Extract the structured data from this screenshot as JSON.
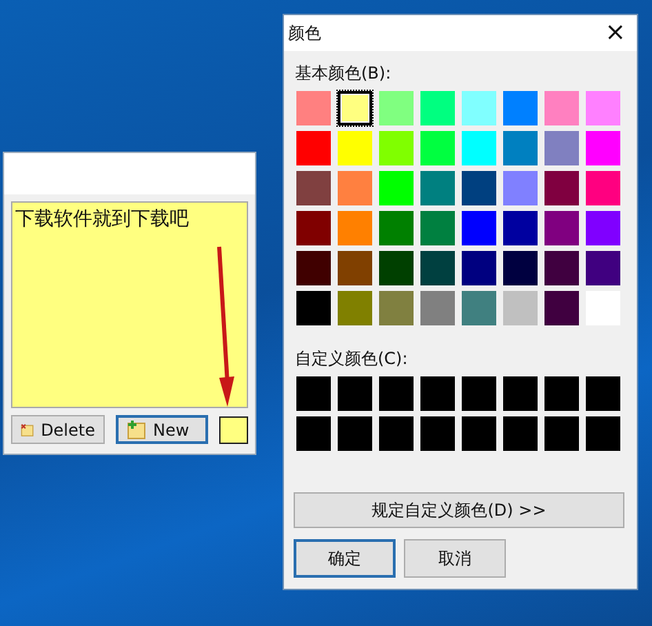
{
  "note": {
    "text": "下载软件就到下载吧",
    "color": "#ffff80",
    "buttons": [
      {
        "label": "Delete",
        "kind": "delete",
        "selected": false
      },
      {
        "label": "New",
        "kind": "new",
        "selected": true
      }
    ]
  },
  "dialog": {
    "title": "颜色",
    "close": "×",
    "basic_label": "基本颜色(B):",
    "basic_colors": [
      {
        "color": "#ff8080",
        "selected": false
      },
      {
        "color": "#ffff80",
        "selected": true
      },
      {
        "color": "#80ff80",
        "selected": false
      },
      {
        "color": "#00ff80",
        "selected": false
      },
      {
        "color": "#80ffff",
        "selected": false
      },
      {
        "color": "#0080ff",
        "selected": false
      },
      {
        "color": "#ff80c0",
        "selected": false
      },
      {
        "color": "#ff80ff",
        "selected": false
      },
      {
        "color": "#ff0000",
        "selected": false
      },
      {
        "color": "#ffff00",
        "selected": false
      },
      {
        "color": "#80ff00",
        "selected": false
      },
      {
        "color": "#00ff40",
        "selected": false
      },
      {
        "color": "#00ffff",
        "selected": false
      },
      {
        "color": "#0080c0",
        "selected": false
      },
      {
        "color": "#8080c0",
        "selected": false
      },
      {
        "color": "#ff00ff",
        "selected": false
      },
      {
        "color": "#804040",
        "selected": false
      },
      {
        "color": "#ff8040",
        "selected": false
      },
      {
        "color": "#00ff00",
        "selected": false
      },
      {
        "color": "#008080",
        "selected": false
      },
      {
        "color": "#004080",
        "selected": false
      },
      {
        "color": "#8080ff",
        "selected": false
      },
      {
        "color": "#800040",
        "selected": false
      },
      {
        "color": "#ff0080",
        "selected": false
      },
      {
        "color": "#800000",
        "selected": false
      },
      {
        "color": "#ff8000",
        "selected": false
      },
      {
        "color": "#008000",
        "selected": false
      },
      {
        "color": "#008040",
        "selected": false
      },
      {
        "color": "#0000ff",
        "selected": false
      },
      {
        "color": "#0000a0",
        "selected": false
      },
      {
        "color": "#800080",
        "selected": false
      },
      {
        "color": "#8000ff",
        "selected": false
      },
      {
        "color": "#400000",
        "selected": false
      },
      {
        "color": "#804000",
        "selected": false
      },
      {
        "color": "#004000",
        "selected": false
      },
      {
        "color": "#004040",
        "selected": false
      },
      {
        "color": "#000080",
        "selected": false
      },
      {
        "color": "#000040",
        "selected": false
      },
      {
        "color": "#400040",
        "selected": false
      },
      {
        "color": "#400080",
        "selected": false
      },
      {
        "color": "#000000",
        "selected": false
      },
      {
        "color": "#808000",
        "selected": false
      },
      {
        "color": "#808040",
        "selected": false
      },
      {
        "color": "#808080",
        "selected": false
      },
      {
        "color": "#408080",
        "selected": false
      },
      {
        "color": "#c0c0c0",
        "selected": false
      },
      {
        "color": "#400040",
        "selected": false
      },
      {
        "color": "#ffffff",
        "selected": false
      }
    ],
    "custom_label": "自定义颜色(C):",
    "custom_colors": [
      {
        "color": "#000000",
        "selected": false
      },
      {
        "color": "#000000",
        "selected": false
      },
      {
        "color": "#000000",
        "selected": false
      },
      {
        "color": "#000000",
        "selected": false
      },
      {
        "color": "#000000",
        "selected": false
      },
      {
        "color": "#000000",
        "selected": false
      },
      {
        "color": "#000000",
        "selected": false
      },
      {
        "color": "#000000",
        "selected": false
      },
      {
        "color": "#000000",
        "selected": false
      },
      {
        "color": "#000000",
        "selected": false
      },
      {
        "color": "#000000",
        "selected": false
      },
      {
        "color": "#000000",
        "selected": false
      },
      {
        "color": "#000000",
        "selected": false
      },
      {
        "color": "#000000",
        "selected": false
      },
      {
        "color": "#000000",
        "selected": false
      },
      {
        "color": "#000000",
        "selected": false
      }
    ],
    "define_button": "规定自定义颜色(D) >>",
    "buttons": [
      {
        "label": "确定",
        "selected": true
      },
      {
        "label": "取消",
        "selected": false
      }
    ]
  }
}
